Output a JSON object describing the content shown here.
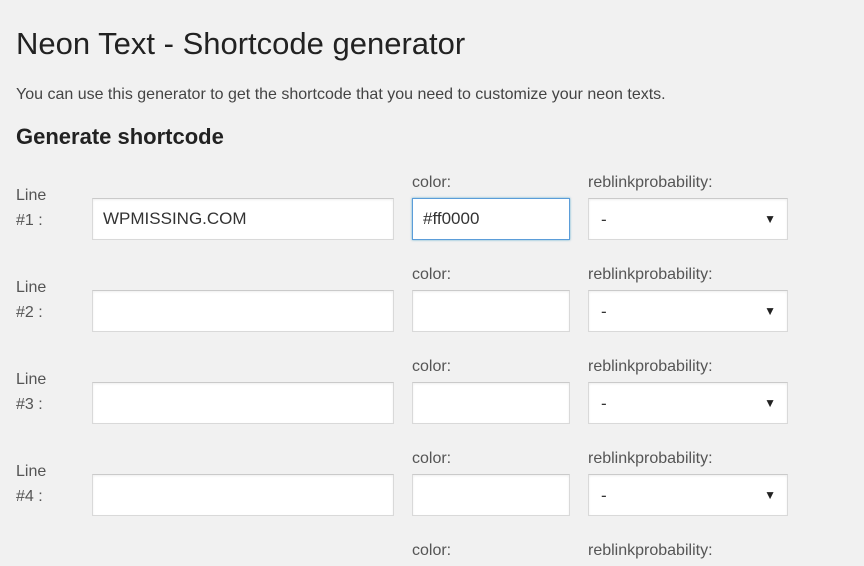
{
  "title": "Neon Text - Shortcode generator",
  "intro": "You can use this generator to get the shortcode that you need to customize your neon texts.",
  "section_title": "Generate shortcode",
  "labels": {
    "color": "color:",
    "reblink": "reblinkprobability:"
  },
  "select_default": "-",
  "lines": [
    {
      "label_a": "Line",
      "label_b": "#1 :",
      "text": "WPMISSING.COM",
      "color": "#ff0000",
      "color_focused": true
    },
    {
      "label_a": "Line",
      "label_b": "#2 :",
      "text": "",
      "color": "",
      "color_focused": false
    },
    {
      "label_a": "Line",
      "label_b": "#3 :",
      "text": "",
      "color": "",
      "color_focused": false
    },
    {
      "label_a": "Line",
      "label_b": "#4 :",
      "text": "",
      "color": "",
      "color_focused": false
    }
  ],
  "cutoff": {
    "color": "color:",
    "reblink": "reblinkprobability:"
  }
}
